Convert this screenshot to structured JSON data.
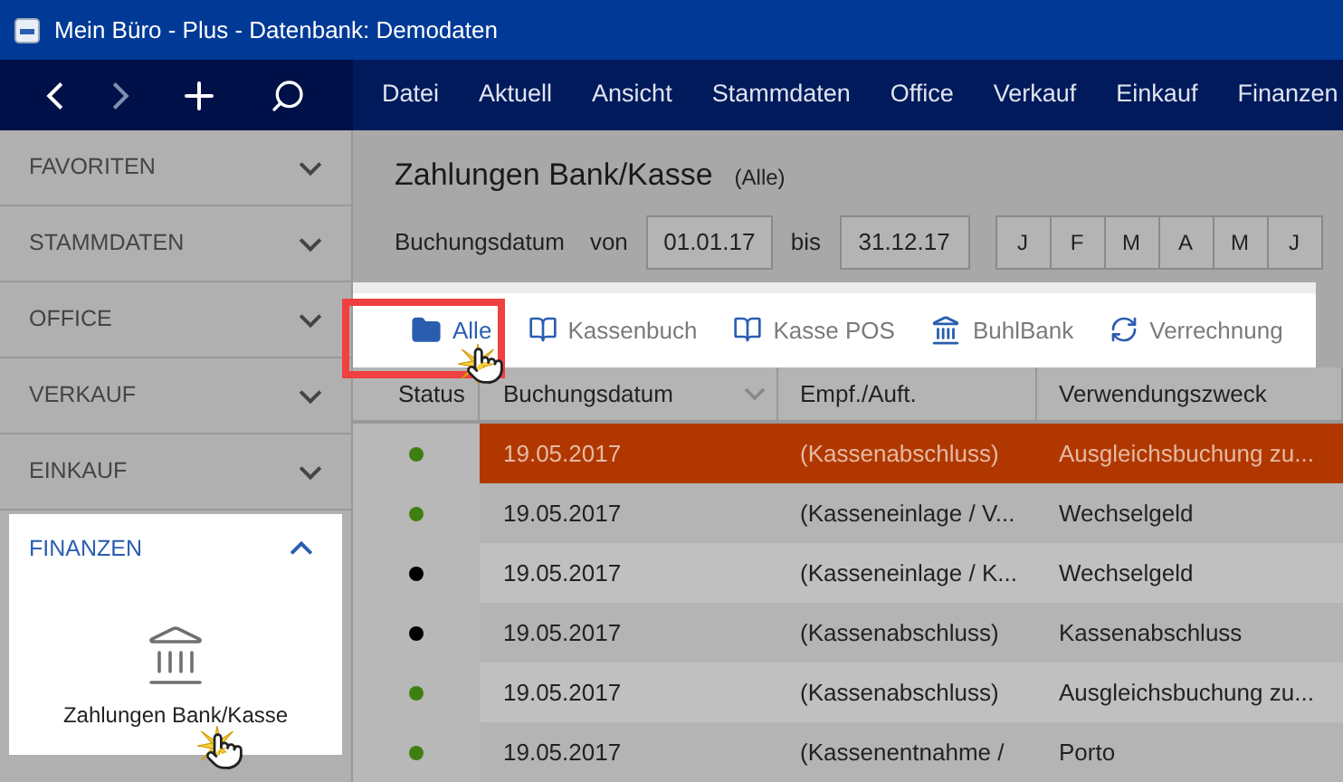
{
  "window": {
    "title": "Mein Büro - Plus - Datenbank: Demodaten"
  },
  "menu": [
    "Datei",
    "Aktuell",
    "Ansicht",
    "Stammdaten",
    "Office",
    "Verkauf",
    "Einkauf",
    "Finanzen"
  ],
  "sidebar": {
    "sections": [
      {
        "label": "FAVORITEN",
        "expanded": false
      },
      {
        "label": "STAMMDATEN",
        "expanded": false
      },
      {
        "label": "OFFICE",
        "expanded": false
      },
      {
        "label": "VERKAUF",
        "expanded": false
      },
      {
        "label": "EINKAUF",
        "expanded": false
      },
      {
        "label": "FINANZEN",
        "expanded": true,
        "items": [
          "Zahlungen Bank/Kasse"
        ]
      }
    ]
  },
  "page": {
    "title": "Zahlungen Bank/Kasse",
    "subtitle": "(Alle)"
  },
  "filter": {
    "label": "Buchungsdatum",
    "from_label": "von",
    "from": "01.01.17",
    "to_label": "bis",
    "to": "31.12.17",
    "months": [
      "J",
      "F",
      "M",
      "A",
      "M",
      "J"
    ]
  },
  "tabs": [
    {
      "label": "Alle",
      "kind": "folder",
      "selected": true
    },
    {
      "label": "Kassenbuch",
      "kind": "book",
      "selected": false
    },
    {
      "label": "Kasse POS",
      "kind": "book",
      "selected": false
    },
    {
      "label": "BuhlBank",
      "kind": "bank",
      "selected": false
    },
    {
      "label": "Verrechnung",
      "kind": "exchange",
      "selected": false
    }
  ],
  "table": {
    "columns": [
      "Status",
      "Buchungsdatum",
      "Empf./Auft.",
      "Verwendungszweck"
    ],
    "rows": [
      {
        "color": "#3f7f12",
        "date": "19.05.2017",
        "party": "(Kassenabschluss)",
        "purpose": "Ausgleichsbuchung zu...",
        "selected": true
      },
      {
        "color": "#3f7f12",
        "date": "19.05.2017",
        "party": "(Kasseneinlage / V...",
        "purpose": "Wechselgeld",
        "selected": false
      },
      {
        "color": "#000000",
        "date": "19.05.2017",
        "party": "(Kasseneinlage / K...",
        "purpose": "Wechselgeld",
        "selected": false
      },
      {
        "color": "#000000",
        "date": "19.05.2017",
        "party": "(Kassenabschluss)",
        "purpose": "Kassenabschluss",
        "selected": false
      },
      {
        "color": "#3f7f12",
        "date": "19.05.2017",
        "party": "(Kassenabschluss)",
        "purpose": "Ausgleichsbuchung zu...",
        "selected": false
      },
      {
        "color": "#3f7f12",
        "date": "19.05.2017",
        "party": "(Kassenentnahme /",
        "purpose": "Porto",
        "selected": false
      }
    ]
  }
}
